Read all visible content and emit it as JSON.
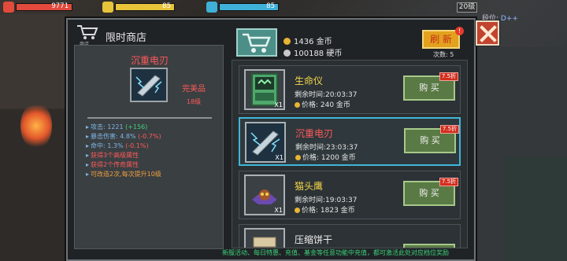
{
  "hud": {
    "hp": {
      "value": "9771",
      "color": "#e14a3c",
      "fill": 1.0
    },
    "energy": {
      "value": "85",
      "color": "#e8c43a",
      "fill": 1.0
    },
    "shield": {
      "value": "85",
      "color": "#3fb0d8",
      "fill": 1.0
    },
    "level": "20级",
    "rank_label": "段位:",
    "rank_value": "D++"
  },
  "shop": {
    "title": "限时商店",
    "cart_label": "商店",
    "gold": "1436 金币",
    "coins": "100188 硬币",
    "refresh_label": "刷 新",
    "refresh_alert": "!",
    "refresh_count": "次数: 5"
  },
  "detail": {
    "name": "沉重电刃",
    "quality": "完美品",
    "level": "18级",
    "stats": [
      {
        "label": "攻击: 1221",
        "delta": "(+156)",
        "delta_type": "up"
      },
      {
        "label": "暴击伤害: 4.8%",
        "delta": "(-0.7%)",
        "delta_type": "down"
      },
      {
        "label": "命中: 1.3%",
        "delta": "(-0.1%)",
        "delta_type": "down"
      }
    ],
    "traits": [
      {
        "text": "获得3个高级属性",
        "style": "red"
      },
      {
        "text": "获得2个传奇属性",
        "style": "red"
      },
      {
        "text": "可改造2次,每次提升10级",
        "style": "orange"
      }
    ]
  },
  "items": [
    {
      "name": "生命仪",
      "name_color": "#f3d64a",
      "time": "剩余时间:20:03:37",
      "price": "价格: 240 金币",
      "qty": "X1",
      "discount": "7.5折",
      "buy": "购 买",
      "selected": false
    },
    {
      "name": "沉重电刃",
      "name_color": "#ff5a5a",
      "time": "剩余时间:23:03:37",
      "price": "价格: 1200 金币",
      "qty": "X1",
      "discount": "7.5折",
      "buy": "购 买",
      "selected": true
    },
    {
      "name": "猫头鹰",
      "name_color": "#f3d64a",
      "time": "剩余时间:19:03:37",
      "price": "价格: 1823 金币",
      "qty": "X1",
      "discount": "7.5折",
      "buy": "购 买",
      "selected": false
    },
    {
      "name": "压缩饼干",
      "name_color": "#f0f0f0",
      "time": "",
      "price": "",
      "qty": "",
      "discount": "",
      "buy": "",
      "selected": false
    }
  ],
  "ticker": "新服活动、每日特惠、充值、基金等任意功能中充值，都可激活此处对应档位奖励"
}
